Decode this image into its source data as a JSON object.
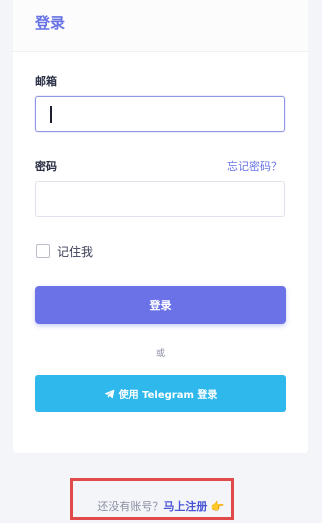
{
  "header": {
    "title": "登录"
  },
  "form": {
    "email_label": "邮箱",
    "email_value": "",
    "password_label": "密码",
    "password_value": "",
    "forgot_label": "忘记密码？",
    "remember_label": "记住我",
    "remember_checked": false,
    "submit_label": "登录",
    "or_text": "或",
    "telegram_label": "使用 Telegram 登录"
  },
  "footer": {
    "prompt": "还没有账号？",
    "signup_label": "马上注册",
    "emoji": "👉"
  },
  "colors": {
    "accent": "#6772e5",
    "primary_button": "#6b72e8",
    "telegram_button": "#2fb8ec",
    "highlight_border": "#e04a4a"
  },
  "icons": {
    "telegram": "paper-plane-icon",
    "checkbox": "checkbox-icon",
    "pointing": "pointing-hand-icon"
  }
}
